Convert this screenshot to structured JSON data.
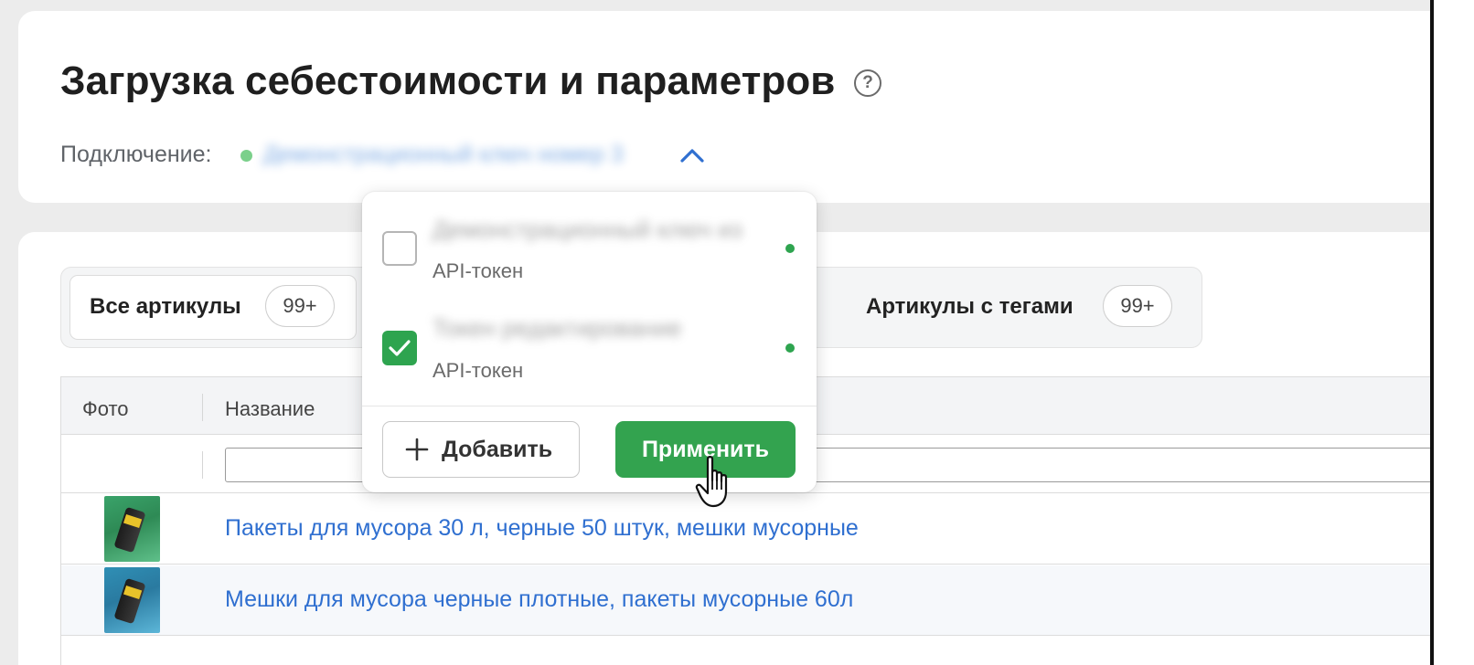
{
  "header": {
    "title": "Загрузка себестоимости и параметров",
    "help_icon": "?",
    "connection_label": "Подключение:",
    "connection_value": "Демонстрационный ключ номер 3",
    "connection_status_color": "#7bd08b"
  },
  "tabs": [
    {
      "label": "Все артикулы",
      "count": "99+",
      "active": true
    },
    {
      "label": "Артикулы с тегами",
      "count": "99+",
      "active": false
    }
  ],
  "table": {
    "columns": [
      "Фото",
      "Название"
    ],
    "rows": [
      {
        "name": "Пакеты для мусора 30 л, черные 50 штук, мешки мусорные"
      },
      {
        "name": "Мешки для мусора черные плотные, пакеты мусорные 60л"
      }
    ]
  },
  "dropdown": {
    "options": [
      {
        "name": "Демонстрационный ключ из",
        "type": "API-токен",
        "checked": false
      },
      {
        "name": "Токен редактирование",
        "type": "API-токен",
        "checked": true
      }
    ],
    "add_label": "Добавить",
    "apply_label": "Применить"
  },
  "colors": {
    "accent_green": "#33a34f",
    "link_blue": "#2f6fd0"
  }
}
